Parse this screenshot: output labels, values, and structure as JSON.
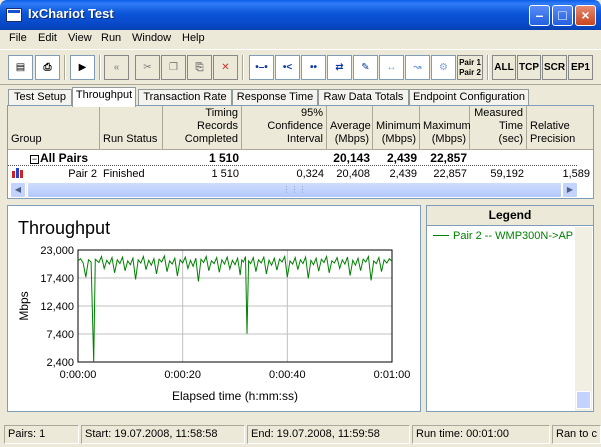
{
  "window": {
    "title": "IxChariot Test"
  },
  "menu": [
    "File",
    "Edit",
    "View",
    "Run",
    "Window",
    "Help"
  ],
  "toolbar": {
    "pair_label_1": "Pair 1",
    "pair_label_2": "Pair 2",
    "all": "ALL",
    "tcp": "TCP",
    "scr": "SCR",
    "ep1": "EP1"
  },
  "tabs": [
    "Test Setup",
    "Throughput",
    "Transaction Rate",
    "Response Time",
    "Raw Data Totals",
    "Endpoint Configuration"
  ],
  "active_tab": "Throughput",
  "grid": {
    "columns": [
      {
        "line1": "",
        "line2": "Group"
      },
      {
        "line1": "",
        "line2": "Run Status"
      },
      {
        "line1": "Timing Records",
        "line2": "Completed"
      },
      {
        "line1": "95% Confidence",
        "line2": "Interval"
      },
      {
        "line1": "Average",
        "line2": "(Mbps)"
      },
      {
        "line1": "Minimum",
        "line2": "(Mbps)"
      },
      {
        "line1": "Maximum",
        "line2": "(Mbps)"
      },
      {
        "line1": "Measured",
        "line2": "Time (sec)"
      },
      {
        "line1": "Relative",
        "line2": "Precision"
      }
    ],
    "all_pairs": {
      "group": "All Pairs",
      "timing_records": "1 510",
      "average": "20,143",
      "minimum": "2,439",
      "maximum": "22,857"
    },
    "pair_row": {
      "group": "Pair 2",
      "status": "Finished",
      "timing_records": "1 510",
      "confidence": "0,324",
      "average": "20,408",
      "minimum": "2,439",
      "maximum": "22,857",
      "measured_time": "59,192",
      "precision": "1,589"
    }
  },
  "chart": {
    "heading": "Throughput"
  },
  "chart_data": {
    "type": "line",
    "ylabel": "Mbps",
    "xlabel": "Elapsed time (h:mm:ss)",
    "yticks": [
      "23,000",
      "17,400",
      "12,400",
      "7,400",
      "2,400"
    ],
    "xticks": [
      "0:00:00",
      "0:00:20",
      "0:00:40",
      "0:01:00"
    ],
    "ylim": [
      2.4,
      23.0
    ],
    "xlim": [
      0,
      60
    ],
    "grid": true,
    "series": [
      {
        "name": "Pair 2 -- WMP300N->AP",
        "color": "#008000",
        "points": [
          [
            0,
            21.0
          ],
          [
            0.5,
            21.4
          ],
          [
            1,
            20.6
          ],
          [
            1.5,
            18.0
          ],
          [
            2,
            21.2
          ],
          [
            2.5,
            20.8
          ],
          [
            3,
            2.4
          ],
          [
            3.3,
            21.3
          ],
          [
            4,
            20.7
          ],
          [
            4.5,
            21.8
          ],
          [
            5,
            19.6
          ],
          [
            5.5,
            21.1
          ],
          [
            6,
            20.4
          ],
          [
            6.5,
            21.6
          ],
          [
            7,
            18.8
          ],
          [
            7.5,
            21.2
          ],
          [
            8,
            20.5
          ],
          [
            8.5,
            21.7
          ],
          [
            9,
            19.2
          ],
          [
            9.5,
            21.0
          ],
          [
            10,
            20.3
          ],
          [
            10.5,
            21.5
          ],
          [
            11,
            17.6
          ],
          [
            11.5,
            21.2
          ],
          [
            12,
            20.6
          ],
          [
            12.5,
            21.8
          ],
          [
            13,
            19.4
          ],
          [
            13.5,
            21.1
          ],
          [
            14,
            20.2
          ],
          [
            14.5,
            21.4
          ],
          [
            15,
            18.6
          ],
          [
            15.5,
            21.3
          ],
          [
            16,
            20.8
          ],
          [
            16.5,
            21.9
          ],
          [
            17,
            19.0
          ],
          [
            17.5,
            21.0
          ],
          [
            18,
            20.4
          ],
          [
            18.5,
            21.5
          ],
          [
            19,
            18.2
          ],
          [
            19.5,
            21.2
          ],
          [
            20,
            20.6
          ],
          [
            20.5,
            21.7
          ],
          [
            21,
            19.6
          ],
          [
            21.5,
            21.1
          ],
          [
            22,
            20.0
          ],
          [
            22.5,
            21.5
          ],
          [
            23,
            17.2
          ],
          [
            23.5,
            21.3
          ],
          [
            24,
            20.7
          ],
          [
            24.5,
            21.8
          ],
          [
            25,
            19.2
          ],
          [
            25.5,
            21.0
          ],
          [
            26,
            20.5
          ],
          [
            26.5,
            21.6
          ],
          [
            27,
            18.9
          ],
          [
            27.5,
            21.2
          ],
          [
            28,
            20.4
          ],
          [
            28.5,
            21.7
          ],
          [
            29,
            19.5
          ],
          [
            29.5,
            21.1
          ],
          [
            30,
            20.3
          ],
          [
            30.5,
            21.5
          ],
          [
            31,
            18.4
          ],
          [
            31.3,
            21.2
          ],
          [
            31.6,
            20.8
          ],
          [
            32,
            21.8
          ],
          [
            32.3,
            7.6
          ],
          [
            32.6,
            21.0
          ],
          [
            33,
            20.5
          ],
          [
            33.5,
            21.6
          ],
          [
            34,
            19.0
          ],
          [
            34.5,
            21.2
          ],
          [
            35,
            20.6
          ],
          [
            35.5,
            21.7
          ],
          [
            36,
            18.6
          ],
          [
            36.5,
            21.1
          ],
          [
            37,
            20.2
          ],
          [
            37.5,
            21.5
          ],
          [
            38,
            19.3
          ],
          [
            38.5,
            21.3
          ],
          [
            39,
            20.8
          ],
          [
            39.5,
            21.8
          ],
          [
            40,
            18.0
          ],
          [
            40.5,
            21.0
          ],
          [
            41,
            20.4
          ],
          [
            41.5,
            21.6
          ],
          [
            42,
            19.4
          ],
          [
            42.5,
            21.2
          ],
          [
            43,
            20.5
          ],
          [
            43.5,
            21.7
          ],
          [
            44,
            17.8
          ],
          [
            44.5,
            21.1
          ],
          [
            45,
            20.3
          ],
          [
            45.5,
            21.5
          ],
          [
            46,
            19.1
          ],
          [
            46.5,
            21.3
          ],
          [
            47,
            20.7
          ],
          [
            47.5,
            21.8
          ],
          [
            48,
            18.8
          ],
          [
            48.5,
            21.0
          ],
          [
            49,
            20.6
          ],
          [
            49.5,
            21.6
          ],
          [
            50,
            19.6
          ],
          [
            50.5,
            21.2
          ],
          [
            51,
            20.4
          ],
          [
            51.5,
            21.7
          ],
          [
            52,
            18.3
          ],
          [
            52.5,
            21.1
          ],
          [
            53,
            20.2
          ],
          [
            53.5,
            21.5
          ],
          [
            54,
            19.2
          ],
          [
            54.5,
            21.3
          ],
          [
            55,
            20.8
          ],
          [
            55.5,
            21.8
          ],
          [
            56,
            17.4
          ],
          [
            56.5,
            21.0
          ],
          [
            57,
            20.5
          ],
          [
            57.5,
            21.6
          ],
          [
            58,
            19.0
          ],
          [
            58.5,
            21.2
          ],
          [
            59,
            20.6
          ],
          [
            59.5,
            21.4
          ],
          [
            60,
            20.9
          ]
        ]
      }
    ]
  },
  "legend": {
    "heading": "Legend",
    "item": "Pair 2 -- WMP300N->AP"
  },
  "status": {
    "pairs": "Pairs: 1",
    "start": "Start: 19.07.2008, 11:58:58",
    "end": "End: 19.07.2008, 11:59:58",
    "runtime": "Run time: 00:01:00",
    "ran_to": "Ran to c"
  }
}
